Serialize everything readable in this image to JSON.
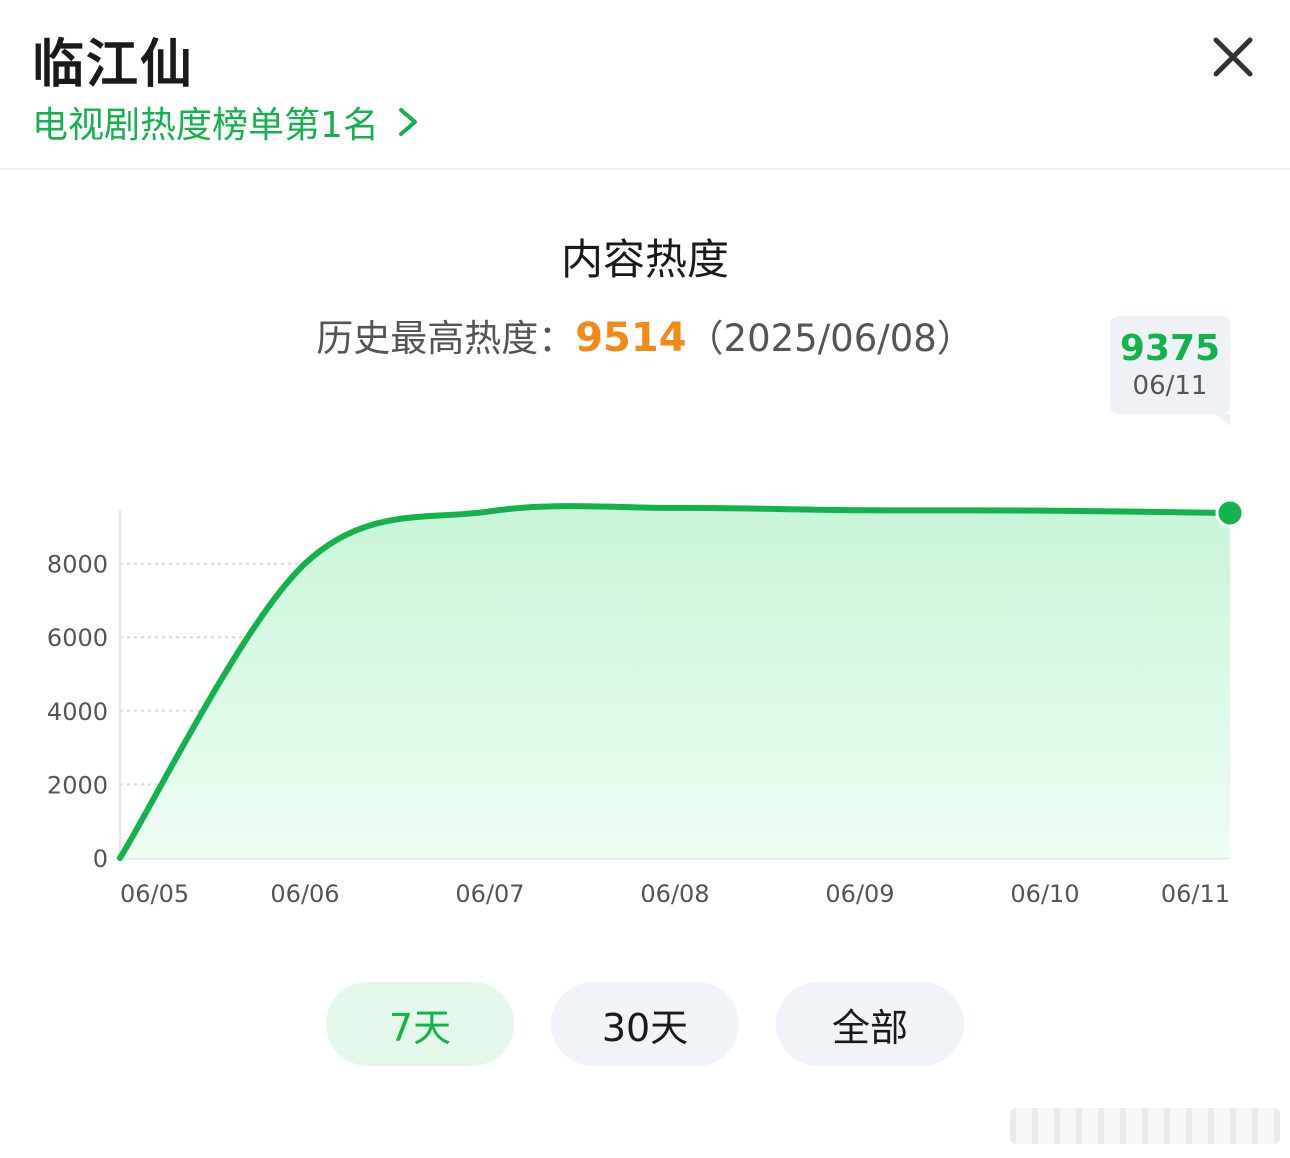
{
  "header": {
    "title": "临江仙",
    "rank_link": "电视剧热度榜单第1名"
  },
  "chart_title": "内容热度",
  "peak": {
    "label": "历史最高热度：",
    "value": "9514",
    "date": "（2025/06/08）"
  },
  "tooltip": {
    "value": "9375",
    "date": "06/11"
  },
  "range_buttons": [
    "7天",
    "30天",
    "全部"
  ],
  "colors": {
    "accent": "#14b24c",
    "peak": "#f28a1a",
    "fill_top": "#c8f5d8",
    "fill_bottom": "#eefdf3"
  },
  "chart_data": {
    "type": "area",
    "x": [
      "06/05",
      "06/06",
      "06/07",
      "06/08",
      "06/09",
      "06/10",
      "06/11"
    ],
    "values": [
      0,
      8000,
      9420,
      9514,
      9450,
      9440,
      9375
    ],
    "yticks": [
      0,
      2000,
      4000,
      6000,
      8000
    ],
    "ylim": [
      0,
      10000
    ],
    "grid": true,
    "highlight_index": 6
  }
}
